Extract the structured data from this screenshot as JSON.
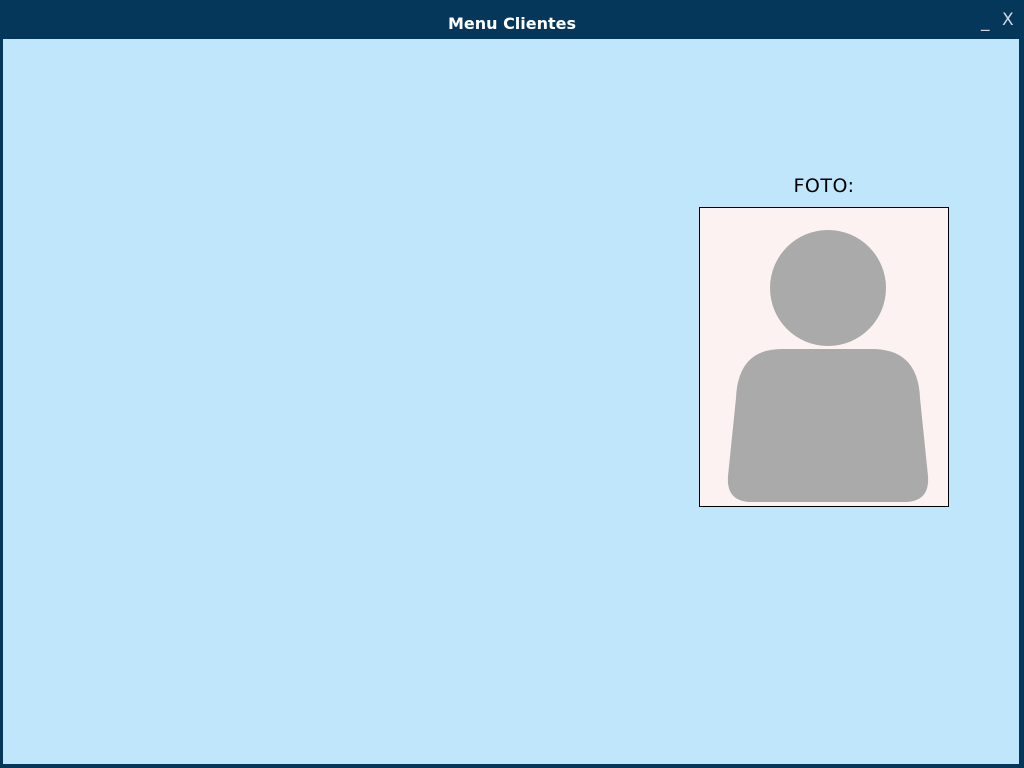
{
  "window": {
    "title": "Menu Clientes",
    "minimize_label": "_",
    "close_label": "X"
  },
  "photo": {
    "label": "FOTO:",
    "placeholder_icon": "user-silhouette-icon"
  },
  "colors": {
    "titlebar": "#05375a",
    "background": "#c0e6fc",
    "photo_bg": "#fcf2f2",
    "silhouette": "#aaaaaa"
  }
}
